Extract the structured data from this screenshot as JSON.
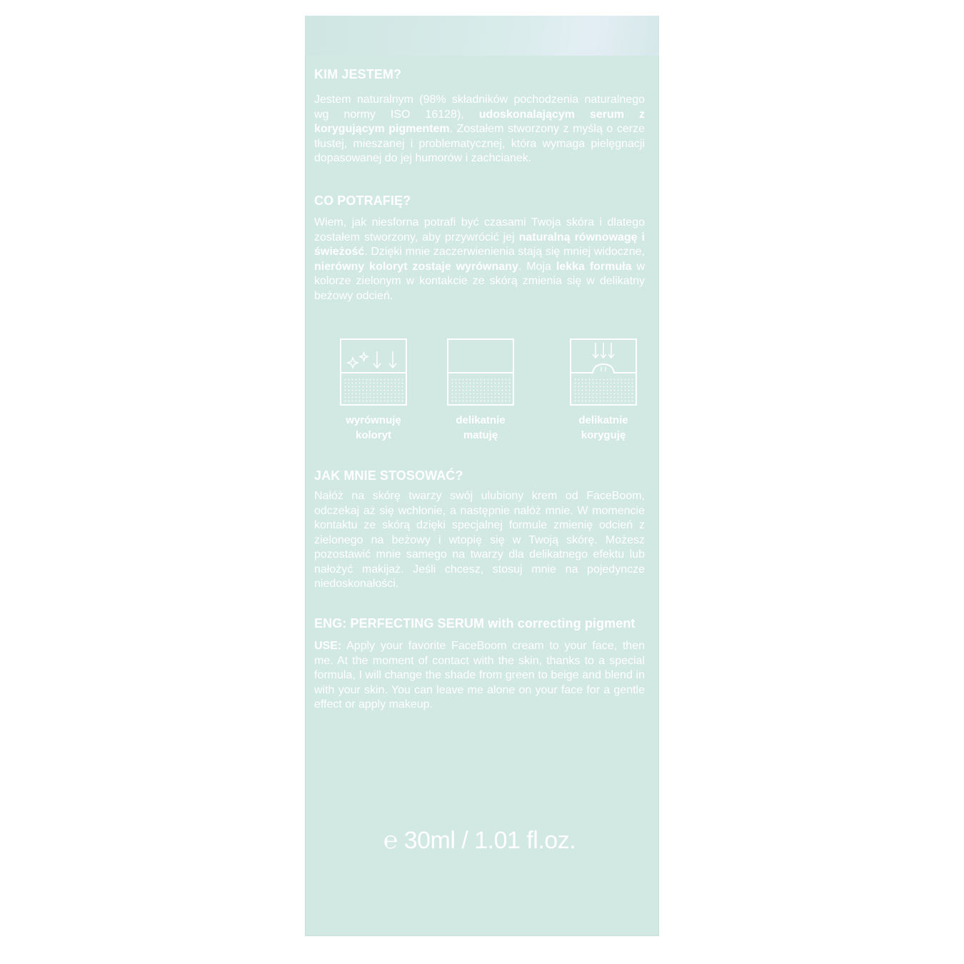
{
  "section1": {
    "title": "KIM JESTEM?",
    "t1": "Jestem naturalnym (98% składników pochodzenia naturalnego wg normy ISO 16128), ",
    "b1": "udoskonalającym serum z korygującym pigmentem",
    "t2": ". Zostałem stworzony z myślą o cerze tłustej, mieszanej i problematycznej, która wymaga pielęgnacji dopasowanej do jej humorów i zachcianek."
  },
  "section2": {
    "title": "CO POTRAFIĘ?",
    "t1": "Wiem, jak niesforna potrafi być czasami Twoja skóra i dlatego zostałem stworzony, aby przywrócić jej ",
    "b1": "naturalną równowagę i świeżość",
    "t2": ". Dzięki mnie zaczerwienienia stają się mniej widoczne, ",
    "b2": "nierówny koloryt zostaje wyrównany",
    "t3": ". Moja ",
    "b3": "lekka formuła",
    "t4": " w kolorze zielonym w kontakcie ze skórą zmienia się w delikatny beżowy odcień."
  },
  "icons": [
    {
      "icon": "even-tone-icon",
      "line1": "wyrównuję",
      "line2": "koloryt"
    },
    {
      "icon": "matte-icon",
      "line1": "delikatnie",
      "line2": "matuję"
    },
    {
      "icon": "correct-icon",
      "line1": "delikatnie",
      "line2": "koryguję"
    }
  ],
  "section3": {
    "title": "JAK MNIE STOSOWAĆ?",
    "text": "Nałóż na skórę twarzy swój ulubiony krem od FaceBoom, odczekaj aż się wchłonie, a następnie nałóż mnie. W momencie kontaktu ze skórą dzięki specjalnej formule zmienię odcień z zielonego na beżowy i wtopię się w Twoją skórę. Możesz pozostawić mnie samego na twarzy dla delikatnego efektu lub nałożyć makijaż. Jeśli chcesz, stosuj mnie na pojedyncze niedoskonałości."
  },
  "section4": {
    "title": "ENG: PERFECTING SERUM with correcting pigment",
    "use_label": "USE:",
    "use_text": " Apply your favorite FaceBoom cream to your face, then me. At the moment of contact with the skin, thanks to a special formula, I will change the shade from green to beige and blend in with your skin. You can leave me alone on your face for a gentle effect or apply makeup."
  },
  "volume": {
    "symbol": "℮",
    "text": "30ml / 1.01 fl.oz."
  },
  "colors": {
    "box": "#d2e8e3",
    "text": "#ffffff"
  }
}
